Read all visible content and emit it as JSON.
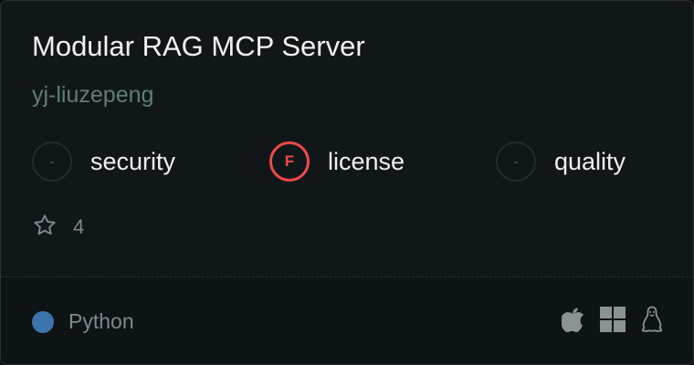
{
  "card": {
    "title": "Modular RAG MCP Server",
    "owner": "yj-liuzepeng"
  },
  "metrics": [
    {
      "label": "security",
      "grade": "-",
      "status": "none"
    },
    {
      "label": "license",
      "grade": "F",
      "status": "fail"
    },
    {
      "label": "quality",
      "grade": "-",
      "status": "none"
    }
  ],
  "stars": {
    "icon": "star-icon",
    "count": "4"
  },
  "footer": {
    "language": "Python",
    "language_color": "#3b74ad",
    "platforms": [
      "apple-icon",
      "windows-icon",
      "linux-icon"
    ]
  },
  "colors": {
    "fail": "#f0494b",
    "owner": "#5f7d76"
  }
}
